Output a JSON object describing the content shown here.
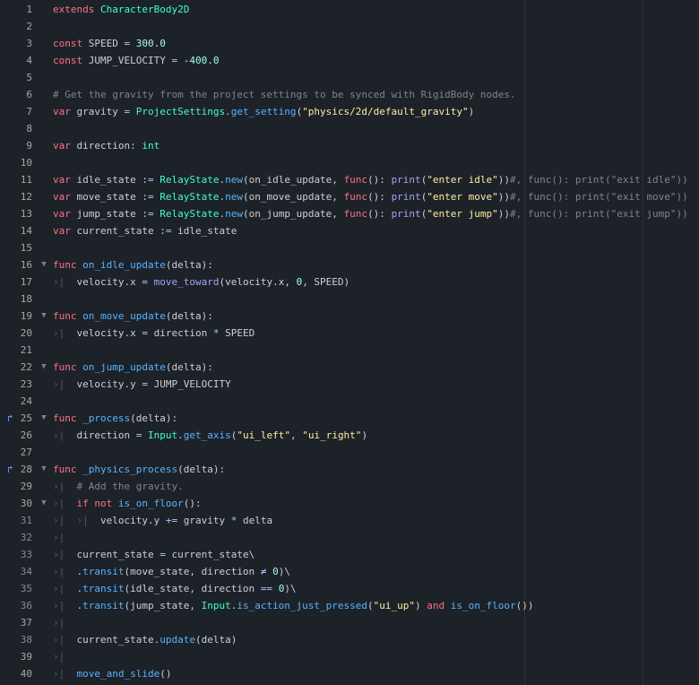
{
  "colors": {
    "background": "#1d2229",
    "keyword": "#ff7085",
    "class": "#42ffc2",
    "number": "#a1ffe0",
    "string": "#ffeda1",
    "comment": "#7f848c",
    "function": "#57b3ff",
    "builtin": "#a3a3f5"
  },
  "lines": [
    {
      "n": "1",
      "indent": 0,
      "tokens": [
        [
          "kw",
          "extends "
        ],
        [
          "cls",
          "CharacterBody2D"
        ]
      ]
    },
    {
      "n": "2",
      "indent": 0,
      "tokens": []
    },
    {
      "n": "3",
      "indent": 0,
      "tokens": [
        [
          "kw",
          "const "
        ],
        [
          "t",
          "SPEED "
        ],
        [
          "op",
          "= "
        ],
        [
          "num",
          "300.0"
        ]
      ]
    },
    {
      "n": "4",
      "indent": 0,
      "tokens": [
        [
          "kw",
          "const "
        ],
        [
          "t",
          "JUMP_VELOCITY "
        ],
        [
          "op",
          "= "
        ],
        [
          "num",
          "-400.0"
        ]
      ]
    },
    {
      "n": "5",
      "indent": 0,
      "tokens": []
    },
    {
      "n": "6",
      "indent": 0,
      "tokens": [
        [
          "cm",
          "# Get the gravity from the project settings to be synced with RigidBody nodes."
        ]
      ]
    },
    {
      "n": "7",
      "indent": 0,
      "tokens": [
        [
          "kw",
          "var "
        ],
        [
          "t",
          "gravity "
        ],
        [
          "op",
          "= "
        ],
        [
          "cls",
          "ProjectSettings"
        ],
        [
          "op",
          "."
        ],
        [
          "fn",
          "get_setting"
        ],
        [
          "t",
          "("
        ],
        [
          "str",
          "\"physics/2d/default_gravity\""
        ],
        [
          "t",
          ")"
        ]
      ]
    },
    {
      "n": "8",
      "indent": 0,
      "tokens": []
    },
    {
      "n": "9",
      "indent": 0,
      "tokens": [
        [
          "kw",
          "var "
        ],
        [
          "t",
          "direction"
        ],
        [
          "op",
          ": "
        ],
        [
          "cls",
          "int"
        ]
      ]
    },
    {
      "n": "10",
      "indent": 0,
      "tokens": []
    },
    {
      "n": "11",
      "indent": 0,
      "tokens": [
        [
          "kw",
          "var "
        ],
        [
          "t",
          "idle_state "
        ],
        [
          "op",
          ":= "
        ],
        [
          "cls",
          "RelayState"
        ],
        [
          "op",
          "."
        ],
        [
          "fn",
          "new"
        ],
        [
          "t",
          "(on_idle_update, "
        ],
        [
          "kw",
          "func"
        ],
        [
          "t",
          "(): "
        ],
        [
          "gfn",
          "print"
        ],
        [
          "t",
          "("
        ],
        [
          "str",
          "\"enter idle\""
        ],
        [
          "t",
          "))"
        ],
        [
          "cm",
          "#, func(): print(\"exit idle\"))"
        ]
      ]
    },
    {
      "n": "12",
      "indent": 0,
      "tokens": [
        [
          "kw",
          "var "
        ],
        [
          "t",
          "move_state "
        ],
        [
          "op",
          ":= "
        ],
        [
          "cls",
          "RelayState"
        ],
        [
          "op",
          "."
        ],
        [
          "fn",
          "new"
        ],
        [
          "t",
          "(on_move_update, "
        ],
        [
          "kw",
          "func"
        ],
        [
          "t",
          "(): "
        ],
        [
          "gfn",
          "print"
        ],
        [
          "t",
          "("
        ],
        [
          "str",
          "\"enter move\""
        ],
        [
          "t",
          "))"
        ],
        [
          "cm",
          "#, func(): print(\"exit move\"))"
        ]
      ]
    },
    {
      "n": "13",
      "indent": 0,
      "tokens": [
        [
          "kw",
          "var "
        ],
        [
          "t",
          "jump_state "
        ],
        [
          "op",
          ":= "
        ],
        [
          "cls",
          "RelayState"
        ],
        [
          "op",
          "."
        ],
        [
          "fn",
          "new"
        ],
        [
          "t",
          "(on_jump_update, "
        ],
        [
          "kw",
          "func"
        ],
        [
          "t",
          "(): "
        ],
        [
          "gfn",
          "print"
        ],
        [
          "t",
          "("
        ],
        [
          "str",
          "\"enter jump\""
        ],
        [
          "t",
          "))"
        ],
        [
          "cm",
          "#, func(): print(\"exit jump\"))"
        ]
      ]
    },
    {
      "n": "14",
      "indent": 0,
      "tokens": [
        [
          "kw",
          "var "
        ],
        [
          "t",
          "current_state "
        ],
        [
          "op",
          ":= "
        ],
        [
          "t",
          "idle_state"
        ]
      ]
    },
    {
      "n": "15",
      "indent": 0,
      "tokens": []
    },
    {
      "n": "16",
      "indent": 0,
      "fold": true,
      "tokens": [
        [
          "kw",
          "func "
        ],
        [
          "fn",
          "on_idle_update"
        ],
        [
          "t",
          "(delta):"
        ]
      ]
    },
    {
      "n": "17",
      "indent": 1,
      "tokens": [
        [
          "t",
          "velocity.x "
        ],
        [
          "op",
          "= "
        ],
        [
          "gfn",
          "move_toward"
        ],
        [
          "t",
          "(velocity.x, "
        ],
        [
          "num",
          "0"
        ],
        [
          "t",
          ", SPEED)"
        ]
      ]
    },
    {
      "n": "18",
      "indent": 0,
      "tokens": []
    },
    {
      "n": "19",
      "indent": 0,
      "fold": true,
      "tokens": [
        [
          "kw",
          "func "
        ],
        [
          "fn",
          "on_move_update"
        ],
        [
          "t",
          "(delta):"
        ]
      ]
    },
    {
      "n": "20",
      "indent": 1,
      "tokens": [
        [
          "t",
          "velocity.x "
        ],
        [
          "op",
          "= "
        ],
        [
          "t",
          "direction "
        ],
        [
          "op",
          "* "
        ],
        [
          "t",
          "SPEED"
        ]
      ]
    },
    {
      "n": "21",
      "indent": 0,
      "tokens": []
    },
    {
      "n": "22",
      "indent": 0,
      "fold": true,
      "tokens": [
        [
          "kw",
          "func "
        ],
        [
          "fn",
          "on_jump_update"
        ],
        [
          "t",
          "(delta):"
        ]
      ]
    },
    {
      "n": "23",
      "indent": 1,
      "tokens": [
        [
          "t",
          "velocity.y "
        ],
        [
          "op",
          "= "
        ],
        [
          "t",
          "JUMP_VELOCITY"
        ]
      ]
    },
    {
      "n": "24",
      "indent": 0,
      "tokens": []
    },
    {
      "n": "25",
      "indent": 0,
      "fold": true,
      "override": true,
      "tokens": [
        [
          "kw",
          "func "
        ],
        [
          "fn",
          "_process"
        ],
        [
          "t",
          "(delta):"
        ]
      ]
    },
    {
      "n": "26",
      "indent": 1,
      "tokens": [
        [
          "t",
          "direction "
        ],
        [
          "op",
          "= "
        ],
        [
          "cls",
          "Input"
        ],
        [
          "op",
          "."
        ],
        [
          "fn",
          "get_axis"
        ],
        [
          "t",
          "("
        ],
        [
          "str",
          "\"ui_left\""
        ],
        [
          "t",
          ", "
        ],
        [
          "str",
          "\"ui_right\""
        ],
        [
          "t",
          ")"
        ]
      ]
    },
    {
      "n": "27",
      "indent": 0,
      "tokens": []
    },
    {
      "n": "28",
      "indent": 0,
      "fold": true,
      "override": true,
      "tokens": [
        [
          "kw",
          "func "
        ],
        [
          "fn",
          "_physics_process"
        ],
        [
          "t",
          "(delta):"
        ]
      ]
    },
    {
      "n": "29",
      "indent": 1,
      "tokens": [
        [
          "cm",
          "# Add the gravity."
        ]
      ]
    },
    {
      "n": "30",
      "indent": 1,
      "fold": true,
      "tokens": [
        [
          "kw",
          "if not "
        ],
        [
          "fn",
          "is_on_floor"
        ],
        [
          "t",
          "():"
        ]
      ]
    },
    {
      "n": "31",
      "indent": 2,
      "dim": true,
      "tokens": [
        [
          "t",
          "velocity.y "
        ],
        [
          "op",
          "+= "
        ],
        [
          "t",
          "gravity "
        ],
        [
          "op",
          "* "
        ],
        [
          "t",
          "delta"
        ]
      ]
    },
    {
      "n": "32",
      "indent": 1,
      "dim": true,
      "tokens": []
    },
    {
      "n": "33",
      "indent": 1,
      "dim": true,
      "tokens": [
        [
          "t",
          "current_state "
        ],
        [
          "op",
          "= "
        ],
        [
          "t",
          "current_state\\"
        ]
      ]
    },
    {
      "n": "34",
      "indent": 1,
      "dim": true,
      "tokens": [
        [
          "op",
          "."
        ],
        [
          "fn",
          "transit"
        ],
        [
          "t",
          "(move_state, direction "
        ],
        [
          "op",
          "≠ "
        ],
        [
          "num",
          "0"
        ],
        [
          "t",
          ")\\"
        ]
      ]
    },
    {
      "n": "35",
      "indent": 1,
      "dim": true,
      "tokens": [
        [
          "op",
          "."
        ],
        [
          "fn",
          "transit"
        ],
        [
          "t",
          "(idle_state, direction "
        ],
        [
          "op",
          "== "
        ],
        [
          "num",
          "0"
        ],
        [
          "t",
          ")\\"
        ]
      ]
    },
    {
      "n": "36",
      "indent": 1,
      "dim": true,
      "tokens": [
        [
          "op",
          "."
        ],
        [
          "fn",
          "transit"
        ],
        [
          "t",
          "(jump_state, "
        ],
        [
          "cls",
          "Input"
        ],
        [
          "op",
          "."
        ],
        [
          "fn",
          "is_action_just_pressed"
        ],
        [
          "t",
          "("
        ],
        [
          "str",
          "\"ui_up\""
        ],
        [
          "t",
          ") "
        ],
        [
          "kw",
          "and "
        ],
        [
          "fn",
          "is_on_floor"
        ],
        [
          "t",
          "())"
        ]
      ]
    },
    {
      "n": "37",
      "indent": 1,
      "tokens": []
    },
    {
      "n": "38",
      "indent": 1,
      "dim": true,
      "tokens": [
        [
          "t",
          "current_state"
        ],
        [
          "op",
          "."
        ],
        [
          "fn",
          "update"
        ],
        [
          "t",
          "(delta)"
        ]
      ]
    },
    {
      "n": "39",
      "indent": 1,
      "tokens": []
    },
    {
      "n": "40",
      "indent": 1,
      "tokens": [
        [
          "fn",
          "move_and_slide"
        ],
        [
          "t",
          "()"
        ]
      ]
    }
  ]
}
